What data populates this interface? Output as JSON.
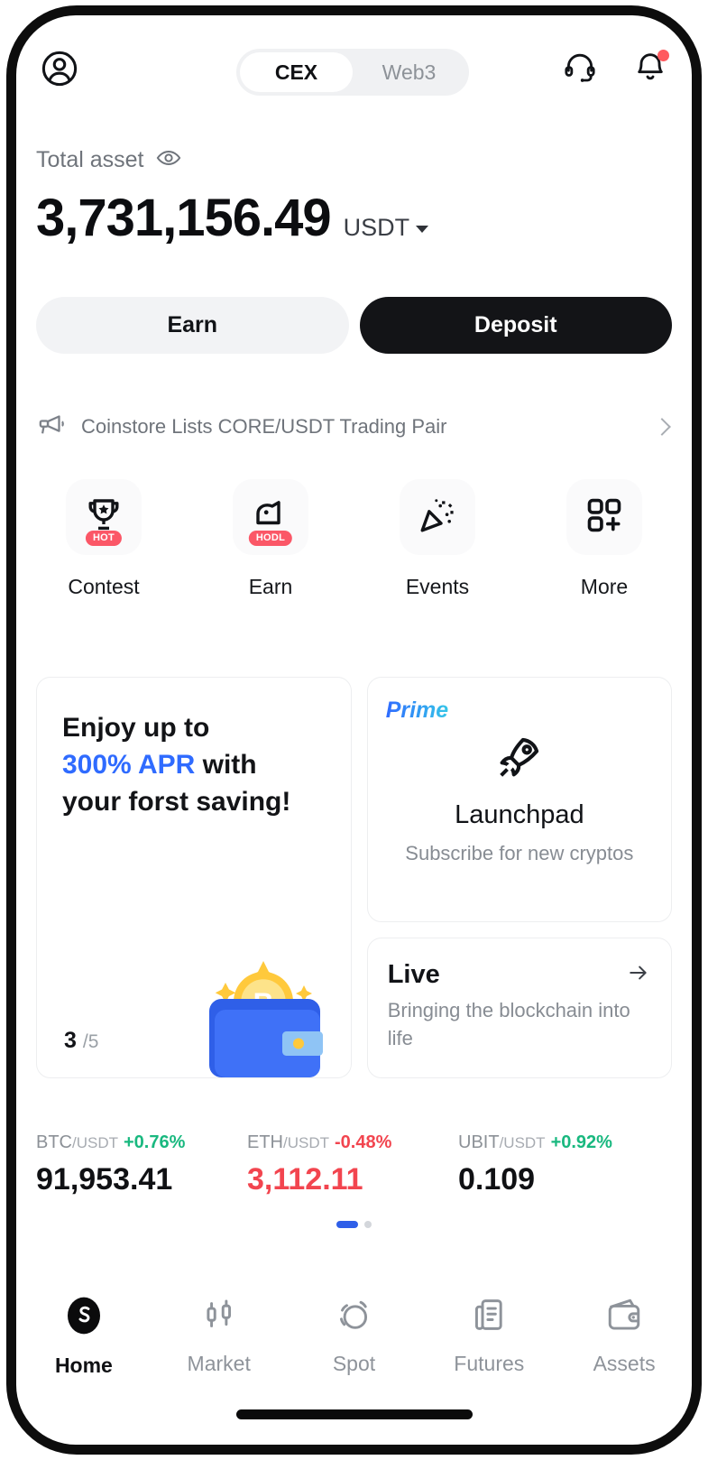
{
  "header": {
    "avatar_icon": "user-circle-icon",
    "tabs": [
      {
        "label": "CEX",
        "active": true
      },
      {
        "label": "Web3",
        "active": false
      }
    ],
    "support_icon": "headset-icon",
    "notification_icon": "bell-icon",
    "notification_badge": true
  },
  "balance": {
    "label": "Total asset",
    "eye_icon": "eye-icon",
    "amount": "3,731,156.49",
    "currency": "USDT",
    "currency_caret": "chevron-down-icon"
  },
  "actions": {
    "earn_label": "Earn",
    "deposit_label": "Deposit"
  },
  "announcement": {
    "icon": "megaphone-icon",
    "text": "Coinstore Lists CORE/USDT Trading Pair",
    "chevron": "chevron-right-icon"
  },
  "quick_actions": [
    {
      "label": "Contest",
      "icon": "trophy-icon",
      "badge": "HOT"
    },
    {
      "label": "Earn",
      "icon": "piggy-bank-icon",
      "badge": "HODL"
    },
    {
      "label": "Events",
      "icon": "party-popper-icon",
      "badge": ""
    },
    {
      "label": "More",
      "icon": "grid-plus-icon",
      "badge": ""
    }
  ],
  "promo": {
    "left": {
      "line1": "Enjoy up to",
      "accent": "300% APR",
      "line2_tail": " with",
      "line3": "your forst saving!",
      "page_current": "3",
      "page_total": "/5",
      "illustration": "wallet-bitcoin-illustration"
    },
    "launchpad": {
      "tag": "Prime",
      "icon": "rocket-icon",
      "title": "Launchpad",
      "subtitle": "Subscribe for new cryptos"
    },
    "live": {
      "title": "Live",
      "arrow_icon": "arrow-right-icon",
      "subtitle": "Bringing the blockchain into life"
    }
  },
  "tickers": [
    {
      "symbol": "BTC",
      "quote": "/USDT",
      "change": "+0.76%",
      "direction": "up",
      "price": "91,953.41",
      "price_negative": false
    },
    {
      "symbol": "ETH",
      "quote": "/USDT",
      "change": "-0.48%",
      "direction": "down",
      "price": "3,112.11",
      "price_negative": true
    },
    {
      "symbol": "UBIT",
      "quote": "/USDT",
      "change": "+0.92%",
      "direction": "up",
      "price": "0.109",
      "price_negative": false
    }
  ],
  "carousel": {
    "active_index": 0,
    "count": 2
  },
  "bottom_nav": [
    {
      "label": "Home",
      "icon": "coinstore-logo-icon",
      "active": true
    },
    {
      "label": "Market",
      "icon": "candlestick-icon",
      "active": false
    },
    {
      "label": "Spot",
      "icon": "swap-icon",
      "active": false
    },
    {
      "label": "Futures",
      "icon": "document-chart-icon",
      "active": false
    },
    {
      "label": "Assets",
      "icon": "wallet-icon",
      "active": false
    }
  ],
  "colors": {
    "accent_blue": "#2f6bff",
    "up_green": "#19b87f",
    "down_red": "#f2454f",
    "badge_red": "#fb5767",
    "dark": "#131417"
  }
}
